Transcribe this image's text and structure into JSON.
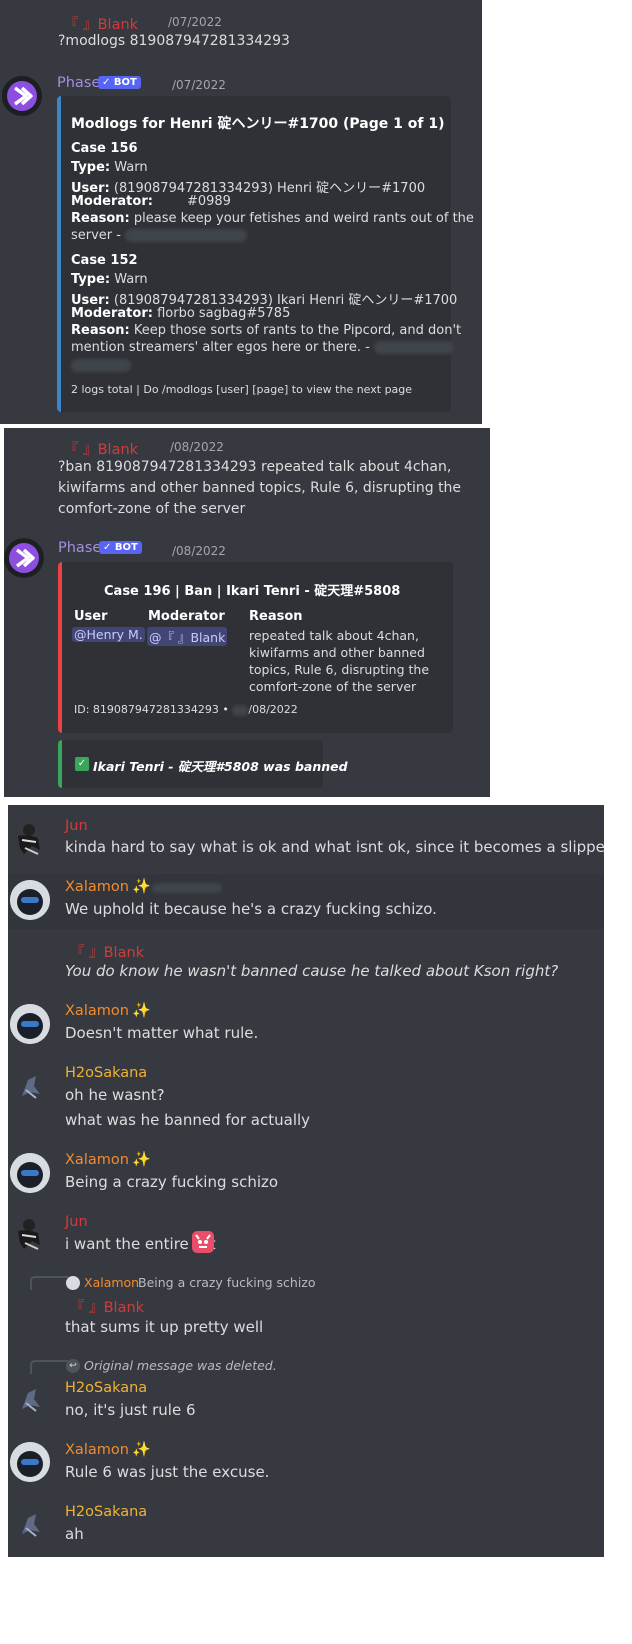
{
  "colors": {
    "background": "#36393f",
    "embed_bg": "#2f3136",
    "blue_bar": "#3a86c8",
    "red_bar": "#ed4245",
    "green_bar": "#3ba55c",
    "red_name": "#d23b3b",
    "orange_name": "#f38c2e",
    "gold_name": "#f0b232",
    "phase_name": "#a58ee0"
  },
  "panel1": {
    "user_name": "『 』Blank",
    "timestamp": "/07/2022",
    "command": "?modlogs 819087947281334293",
    "bot_name": "Phase",
    "bot_tag": "✓ BOT",
    "bot_timestamp": "/07/2022",
    "embed": {
      "title": "Modlogs for Henri 碇ヘンリー#1700 (Page 1 of 1)",
      "case1": {
        "heading": "Case 156",
        "type_label": "Type:",
        "type_value": "Warn",
        "user_label": "User:",
        "user_value": "(819087947281334293) Henri 碇ヘンリー#1700",
        "mod_label": "Moderator:",
        "mod_value": "#0989",
        "reason_label": "Reason:",
        "reason_line1": "please keep your fetishes and weird rants out of the",
        "reason_line2": "server -"
      },
      "case2": {
        "heading": "Case 152",
        "type_label": "Type:",
        "type_value": "Warn",
        "user_label": "User:",
        "user_value": "(819087947281334293) Ikari Henri 碇ヘンリー#1700",
        "mod_label": "Moderator:",
        "mod_value": "florbo sagbag#5785",
        "reason_label": "Reason:",
        "reason_line1": "Keep those sorts of rants to the Pipcord, and don't",
        "reason_line2": "mention streamers' alter egos here or there. -"
      },
      "footer": "2 logs total | Do /modlogs [user] [page] to view the next page"
    }
  },
  "panel2": {
    "user_name": "『 』Blank",
    "timestamp": "/08/2022",
    "command_lines": [
      "?ban 819087947281334293 repeated talk about 4chan,",
      "kiwifarms and other banned topics, Rule 6, disrupting the",
      "comfort-zone of the server"
    ],
    "bot_name": "Phase",
    "bot_tag": "✓ BOT",
    "bot_timestamp": "/08/2022",
    "embed": {
      "title": "Case 196 | Ban | Ikari Tenri - 碇天理#5808",
      "col_user": "User",
      "col_moderator": "Moderator",
      "col_reason": "Reason",
      "user_mention": "@Henry M.",
      "moderator_mention": "@『 』Blank",
      "reason_lines": [
        "repeated talk about 4chan,",
        "kiwifarms and other banned",
        "topics, Rule 6, disrupting the",
        "comfort-zone of the server"
      ],
      "footer_id": "ID: 819087947281334293 •",
      "footer_date": "/08/2022"
    },
    "banned_check": "✓",
    "banned_text": "Ikari Tenri - 碇天理#5808 was banned"
  },
  "panel3": {
    "messages": [
      {
        "author": "Jun",
        "lines": [
          "kinda hard to say what is ok and what isnt ok, since it becomes a slippery slope lol"
        ]
      },
      {
        "author": "Xalamon",
        "lines": [
          "We uphold it because he's a crazy fucking schizo."
        ]
      },
      {
        "author": "『 』Blank",
        "lines": [
          "You do know he wasn't banned cause he talked about Kson right?"
        ]
      },
      {
        "author": "Xalamon",
        "lines": [
          "Doesn't matter what rule."
        ]
      },
      {
        "author": "H2oSakana",
        "lines": [
          "oh he wasnt?",
          "what was he banned for actually"
        ]
      },
      {
        "author": "Xalamon",
        "lines": [
          "Being a crazy fucking schizo"
        ]
      },
      {
        "author": "Jun",
        "lines": [
          "i want the entire list"
        ]
      },
      {
        "author": "『 』Blank",
        "reply_author": "Xalamon",
        "reply_text": "Being a crazy fucking schizo",
        "lines": [
          "that sums it up pretty well"
        ]
      },
      {
        "author": "H2oSakana",
        "reply_text": "Original message was deleted.",
        "lines": [
          "no, it's just rule 6"
        ]
      },
      {
        "author": "Xalamon",
        "lines": [
          "Rule 6 was just the excuse."
        ]
      },
      {
        "author": "H2oSakana",
        "lines": [
          "ah"
        ]
      }
    ]
  }
}
